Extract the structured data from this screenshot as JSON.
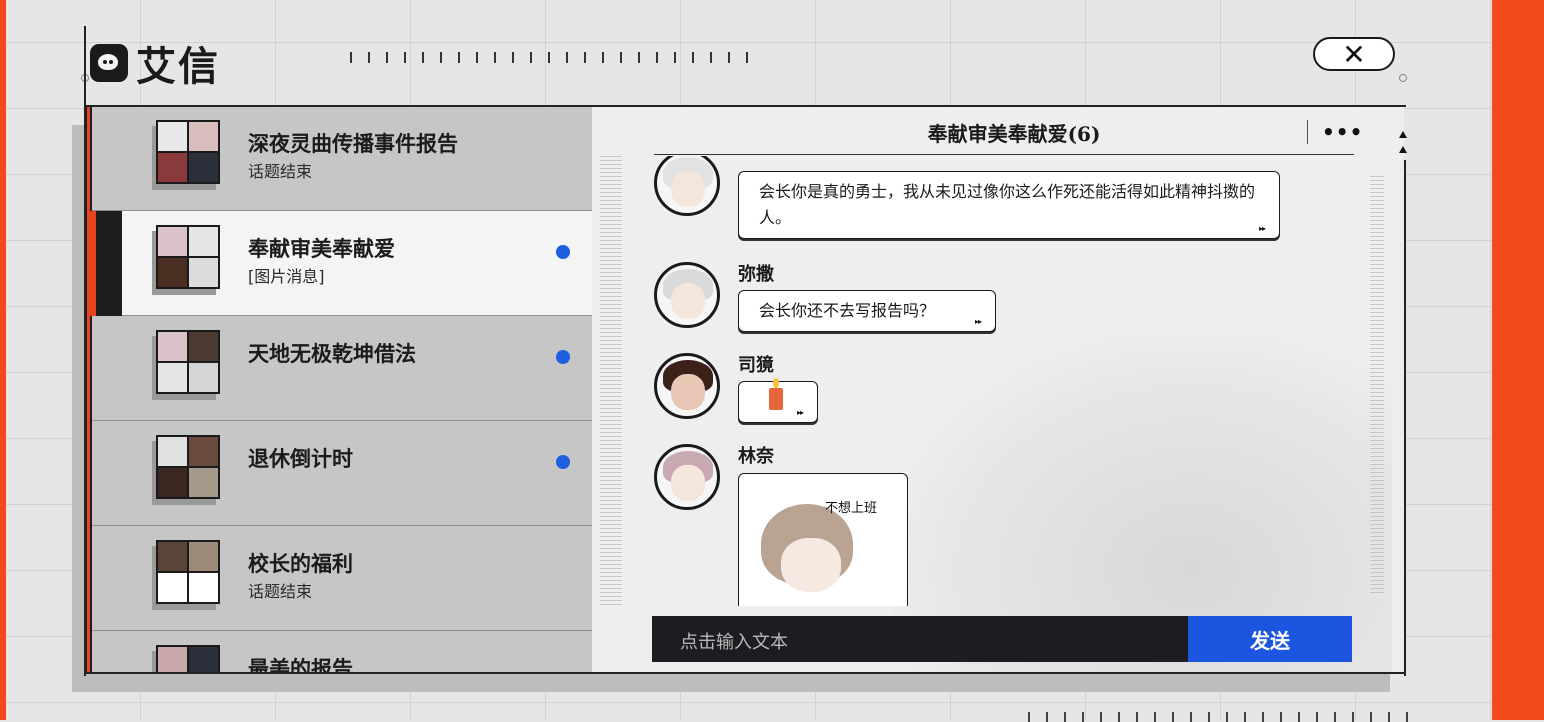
{
  "app": {
    "name": "艾信",
    "close_icon": "close-icon"
  },
  "colors": {
    "accent_orange": "#f24a1d",
    "send_blue": "#1c56e0",
    "unread_dot": "#1e5fe0",
    "dark": "#1d1d21"
  },
  "sidebar": {
    "items": [
      {
        "title": "深夜灵曲传播事件报告",
        "subtitle": "话题结束",
        "unread": false,
        "active": false
      },
      {
        "title": "奉献审美奉献爱",
        "subtitle": "[图片消息]",
        "unread": true,
        "active": true
      },
      {
        "title": "天地无极乾坤借法",
        "subtitle": "",
        "unread": true,
        "active": false
      },
      {
        "title": "退休倒计时",
        "subtitle": "",
        "unread": true,
        "active": false
      },
      {
        "title": "校长的福利",
        "subtitle": "话题结束",
        "unread": false,
        "active": false
      },
      {
        "title": "最美的报告",
        "subtitle": "",
        "unread": false,
        "active": false
      }
    ]
  },
  "chat": {
    "title": "奉献审美奉献爱(6)",
    "more_label": "•••",
    "messages": [
      {
        "sender": "",
        "text": "会长你是真的勇士，我从未见过像你这么作死还能活得如此精神抖擞的人。"
      },
      {
        "sender": "弥撒",
        "text": "会长你还不去写报告吗？"
      },
      {
        "sender": "司獍",
        "text": "",
        "emoji": "candle-icon"
      },
      {
        "sender": "林奈",
        "text": "",
        "sticker_caption": "不想上班"
      }
    ],
    "input_placeholder": "点击输入文本",
    "send_label": "发送"
  }
}
